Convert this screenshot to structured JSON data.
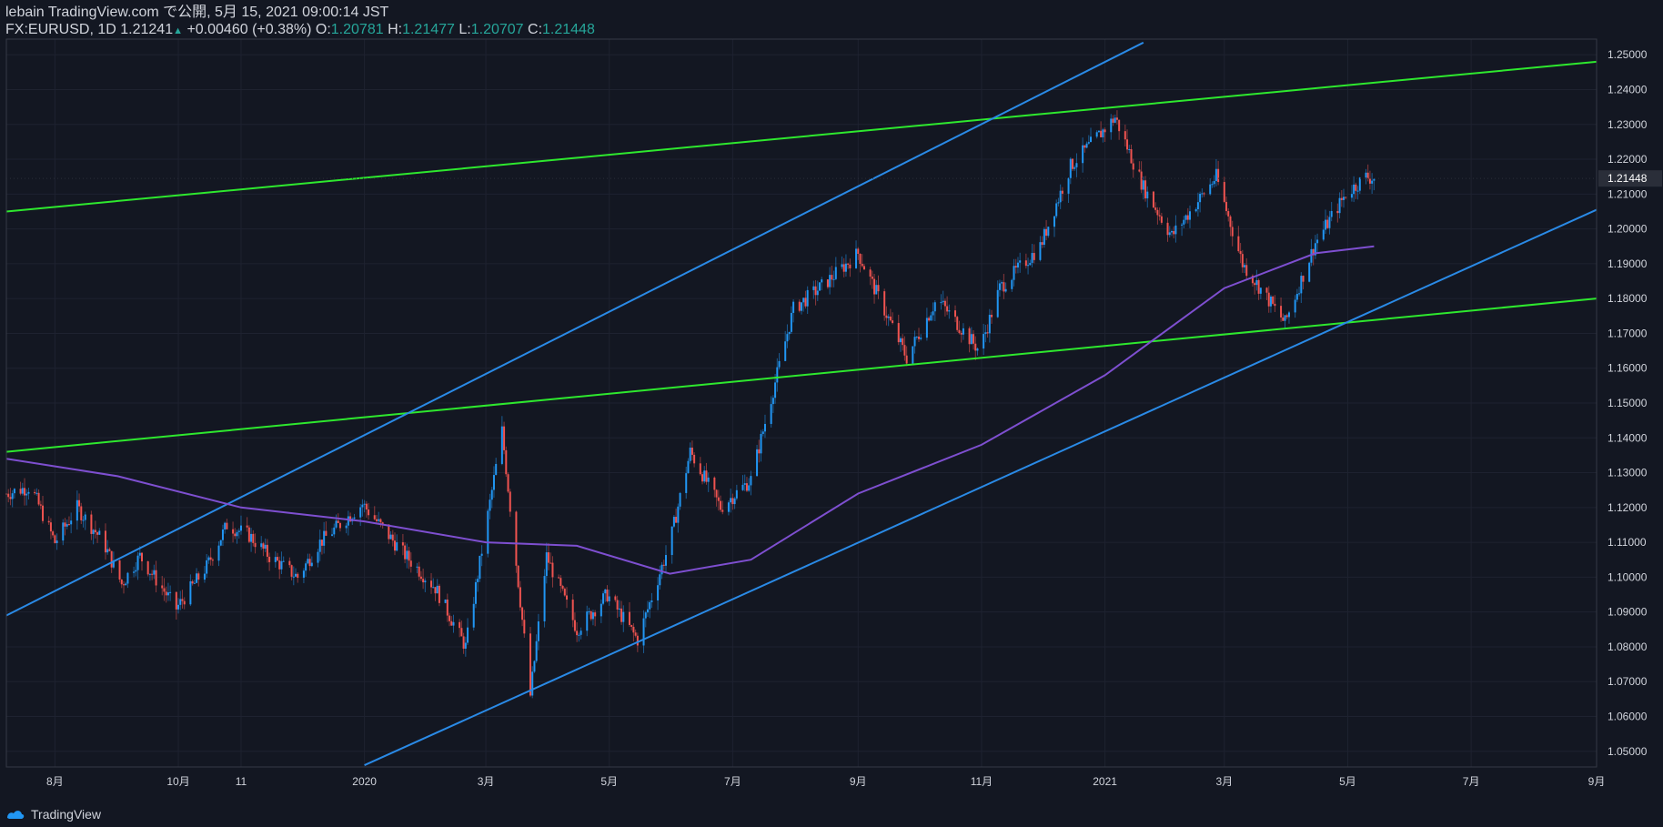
{
  "header": {
    "published": "lebain TradingView.com で公開, 5月 15, 2021 09:00:14 JST",
    "symbol": "FX:EURUSD, 1D",
    "last": "1.21241",
    "change": "+0.00460 (+0.38%)",
    "o_label": "O:",
    "o": "1.20781",
    "h_label": "H:",
    "h": "1.21477",
    "l_label": "L:",
    "l": "1.20707",
    "c_label": "C:",
    "c": "1.21448"
  },
  "footer": {
    "brand": "TradingView"
  },
  "colors": {
    "background": "#131722",
    "grid": "#1e2230",
    "bull": "#2196f3",
    "bear": "#ef5350",
    "green_line": "#2ee82e",
    "blue_line": "#2a8ae6",
    "ma": "#7e4fd0",
    "axis_text": "#d1d4dc"
  },
  "chart_data": {
    "type": "candlestick",
    "symbol": "FX:EURUSD",
    "interval": "1D",
    "current_price_label": "1.21448",
    "x_ticks": [
      "8月",
      "10月",
      "11",
      "2020",
      "3月",
      "5月",
      "7月",
      "9月",
      "11月",
      "2021",
      "3月",
      "5月",
      "7月",
      "9月"
    ],
    "x_dates": [
      "2019-08-01",
      "2019-10-01",
      "2019-11-01",
      "2020-01-01",
      "2020-03-01",
      "2020-05-01",
      "2020-07-01",
      "2020-09-01",
      "2020-11-01",
      "2021-01-01",
      "2021-03-01",
      "2021-05-01",
      "2021-07-01",
      "2021-09-01"
    ],
    "x_range": [
      "2019-07-08",
      "2021-09-01"
    ],
    "y_ticks": [
      1.05,
      1.06,
      1.07,
      1.08,
      1.09,
      1.1,
      1.11,
      1.12,
      1.13,
      1.14,
      1.15,
      1.16,
      1.17,
      1.18,
      1.19,
      1.2,
      1.21,
      1.22,
      1.23,
      1.24,
      1.25
    ],
    "ylim": [
      1.0455,
      1.2545
    ],
    "close_path": [
      [
        "2019-07-08",
        1.124
      ],
      [
        "2019-07-20",
        1.126
      ],
      [
        "2019-08-01",
        1.11
      ],
      [
        "2019-08-12",
        1.12
      ],
      [
        "2019-08-25",
        1.11
      ],
      [
        "2019-09-03",
        1.098
      ],
      [
        "2019-09-12",
        1.106
      ],
      [
        "2019-09-30",
        1.091
      ],
      [
        "2019-10-15",
        1.103
      ],
      [
        "2019-10-25",
        1.115
      ],
      [
        "2019-11-05",
        1.112
      ],
      [
        "2019-11-15",
        1.106
      ],
      [
        "2019-11-29",
        1.1
      ],
      [
        "2019-12-10",
        1.11
      ],
      [
        "2019-12-31",
        1.121
      ],
      [
        "2020-01-20",
        1.107
      ],
      [
        "2020-02-05",
        1.097
      ],
      [
        "2020-02-20",
        1.08
      ],
      [
        "2020-03-09",
        1.142
      ],
      [
        "2020-03-23",
        1.066
      ],
      [
        "2020-03-31",
        1.106
      ],
      [
        "2020-04-15",
        1.085
      ],
      [
        "2020-04-30",
        1.095
      ],
      [
        "2020-05-15",
        1.082
      ],
      [
        "2020-05-31",
        1.11
      ],
      [
        "2020-06-10",
        1.136
      ],
      [
        "2020-06-25",
        1.12
      ],
      [
        "2020-07-10",
        1.128
      ],
      [
        "2020-07-31",
        1.177
      ],
      [
        "2020-08-15",
        1.184
      ],
      [
        "2020-09-01",
        1.193
      ],
      [
        "2020-09-25",
        1.163
      ],
      [
        "2020-10-10",
        1.18
      ],
      [
        "2020-10-31",
        1.165
      ],
      [
        "2020-11-10",
        1.183
      ],
      [
        "2020-11-30",
        1.195
      ],
      [
        "2020-12-15",
        1.218
      ],
      [
        "2021-01-06",
        1.232
      ],
      [
        "2021-01-20",
        1.212
      ],
      [
        "2021-02-03",
        1.198
      ],
      [
        "2021-02-25",
        1.215
      ],
      [
        "2021-03-10",
        1.19
      ],
      [
        "2021-03-31",
        1.173
      ],
      [
        "2021-04-15",
        1.196
      ],
      [
        "2021-04-30",
        1.21
      ],
      [
        "2021-05-10",
        1.215
      ],
      [
        "2021-05-14",
        1.2144
      ]
    ],
    "ma": [
      [
        "2019-07-08",
        1.134
      ],
      [
        "2019-09-01",
        1.129
      ],
      [
        "2019-11-01",
        1.12
      ],
      [
        "2020-01-01",
        1.116
      ],
      [
        "2020-03-01",
        1.11
      ],
      [
        "2020-04-15",
        1.109
      ],
      [
        "2020-05-31",
        1.101
      ],
      [
        "2020-07-10",
        1.105
      ],
      [
        "2020-09-01",
        1.124
      ],
      [
        "2020-11-01",
        1.138
      ],
      [
        "2021-01-01",
        1.158
      ],
      [
        "2021-03-01",
        1.183
      ],
      [
        "2021-04-15",
        1.193
      ],
      [
        "2021-05-14",
        1.195
      ]
    ],
    "trendlines": [
      {
        "color": "green",
        "from": [
          "2019-07-08",
          1.205
        ],
        "to": [
          "2021-09-01",
          1.248
        ]
      },
      {
        "color": "green",
        "from": [
          "2019-07-08",
          1.136
        ],
        "to": [
          "2021-09-01",
          1.18
        ]
      },
      {
        "color": "blue",
        "from": [
          "2019-07-08",
          1.089
        ],
        "to": [
          "2021-01-20",
          1.2535
        ]
      },
      {
        "color": "blue",
        "from": [
          "2020-01-01",
          1.046
        ],
        "to": [
          "2021-09-01",
          1.2055
        ]
      }
    ]
  }
}
